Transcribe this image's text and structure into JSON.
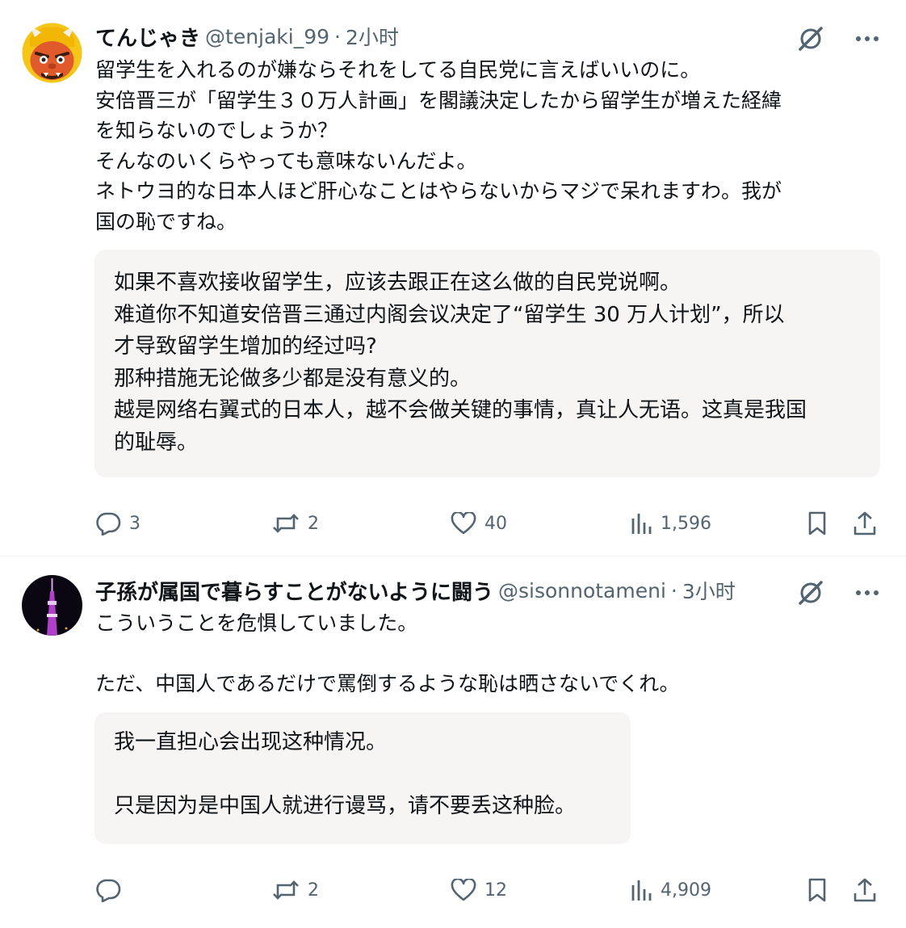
{
  "posts": [
    {
      "author_name": "てんじゃき",
      "handle": "@tenjaki_99",
      "separator": "·",
      "time": "2小时",
      "text": "留学生を入れるのが嫌ならそれをしてる自民党に言えばいいのに。\n安倍晋三が「留学生３０万人計画」を閣議決定したから留学生が増えた経緯\nを知らないのでしょうか？\nそんなのいくらやっても意味ないんだよ。\nネトウヨ的な日本人ほど肝心なことはやらないからマジで呆れますわ。我が\n国の恥ですね。",
      "translation": "如果不喜欢接收留学生，应该去跟正在这么做的自民党说啊。\n难道你不知道安倍晋三通过内阁会议决定了“留学生 30 万人计划”，所以\n才导致留学生增加的经过吗?\n那种措施无论做多少都是没有意义的。\n越是网络右翼式的日本人，越不会做关键的事情，真让人无语。这真是我国\n的耻辱。",
      "replies": "3",
      "retweets": "2",
      "likes": "40",
      "views": "1,596"
    },
    {
      "author_name": "子孫が属国で暮らすことがないように闘う",
      "handle": "@sisonnotameni",
      "separator": "·",
      "time": "3小时",
      "text": "こういうことを危惧していました。\n\nただ、中国人であるだけで罵倒するような恥は晒さないでくれ。",
      "translation": "我一直担心会出现这种情况。\n\n只是因为是中国人就进行谩骂，请不要丢这种脸。",
      "replies": "",
      "retweets": "2",
      "likes": "12",
      "views": "4,909"
    }
  ],
  "icons": [
    "grok-icon",
    "more-icon",
    "reply-icon",
    "retweet-icon",
    "like-icon",
    "views-icon",
    "bookmark-icon",
    "share-icon"
  ],
  "colors": {
    "secondary_text": "#536471",
    "quote_bg": "#f7f5f3",
    "divider": "#eff3f4"
  }
}
